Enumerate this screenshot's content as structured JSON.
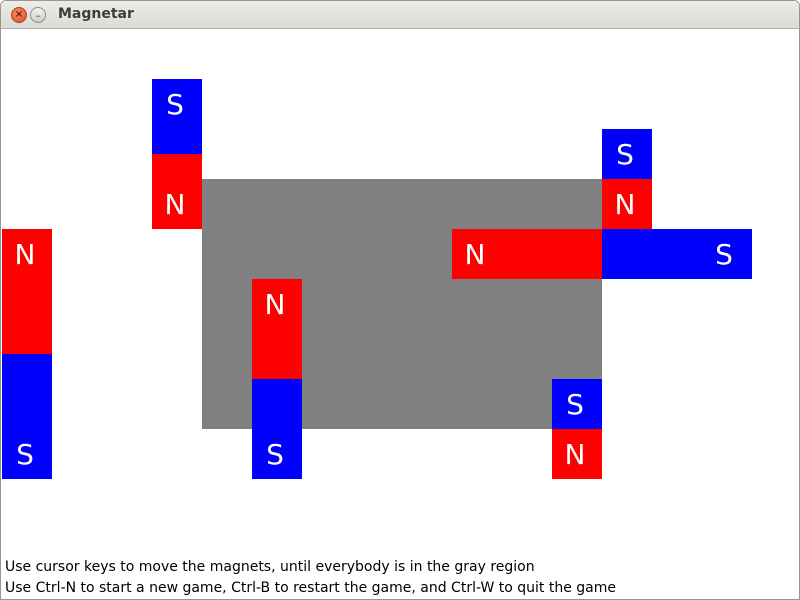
{
  "window": {
    "title": "Magnetar",
    "close_glyph": "×",
    "minimize_glyph": "–"
  },
  "colors": {
    "north": "#ff0000",
    "south": "#0000ff",
    "region": "#808080",
    "background": "#ffffff"
  },
  "magnets": [
    {
      "id": "1",
      "poles": [
        "S",
        "N"
      ]
    },
    {
      "id": "2",
      "poles": [
        "S",
        "N"
      ]
    },
    {
      "id": "3",
      "poles": [
        "N",
        "S"
      ]
    },
    {
      "id": "4",
      "poles": [
        "N",
        "S"
      ]
    },
    {
      "id": "5",
      "poles": [
        "N",
        "S"
      ]
    },
    {
      "id": "6",
      "poles": [
        "S",
        "N"
      ]
    }
  ],
  "instructions": {
    "line1": "Use cursor keys to move the magnets, until everybody is in the gray region",
    "line2": "Use Ctrl-N to start a new game, Ctrl-B to restart the game, and Ctrl-W to quit the game"
  }
}
